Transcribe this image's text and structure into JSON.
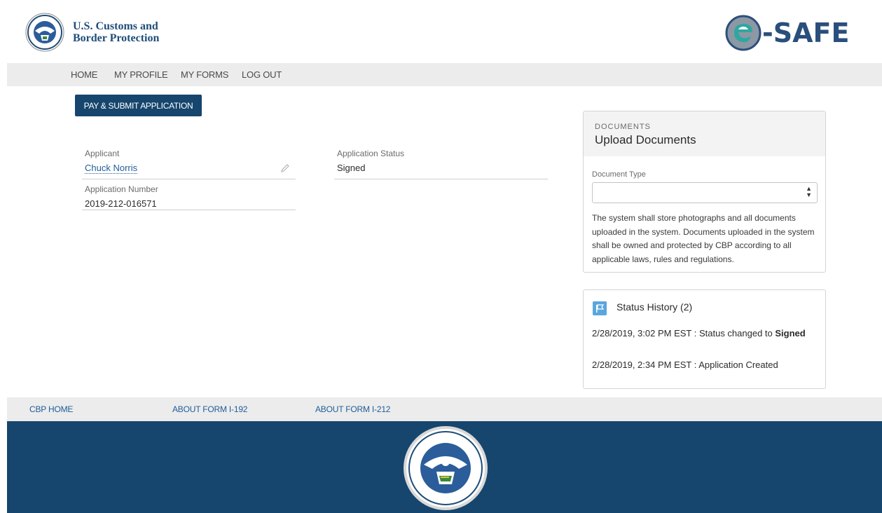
{
  "header": {
    "agency_name_line1": "U.S. Customs and",
    "agency_name_line2": "Border Protection",
    "brand_name": "-SAFE"
  },
  "nav": {
    "items": [
      {
        "label": "HOME"
      },
      {
        "label": "MY PROFILE"
      },
      {
        "label": "MY FORMS"
      },
      {
        "label": "LOG OUT"
      }
    ]
  },
  "actions": {
    "pay_submit_label": "PAY & SUBMIT APPLICATION"
  },
  "application": {
    "applicant_label": "Applicant",
    "applicant_value": "Chuck Norris",
    "status_label": "Application Status",
    "status_value": "Signed",
    "number_label": "Application Number",
    "number_value": "2019-212-016571"
  },
  "documents": {
    "kicker": "DOCUMENTS",
    "title": "Upload Documents",
    "type_label": "Document Type",
    "type_value": "",
    "note": "The system shall store photographs and all documents uploaded in the system. Documents uploaded in the system shall be owned and protected by CBP according to all applicable laws, rules and regulations."
  },
  "status_history": {
    "title": "Status History (2)",
    "entries": [
      {
        "prefix": "2/28/2019, 3:02 PM EST : Status changed to ",
        "bold": "Signed"
      },
      {
        "prefix": "2/28/2019, 2:34 PM EST : Application Created",
        "bold": ""
      }
    ]
  },
  "footer": {
    "links": [
      {
        "label": "CBP HOME"
      },
      {
        "label": "ABOUT FORM I-192"
      },
      {
        "label": "ABOUT FORM I-212"
      }
    ]
  },
  "colors": {
    "primary": "#16456d",
    "link": "#1f5d99",
    "nav_bg": "#ececec",
    "icon_blue": "#5aa6dd"
  }
}
